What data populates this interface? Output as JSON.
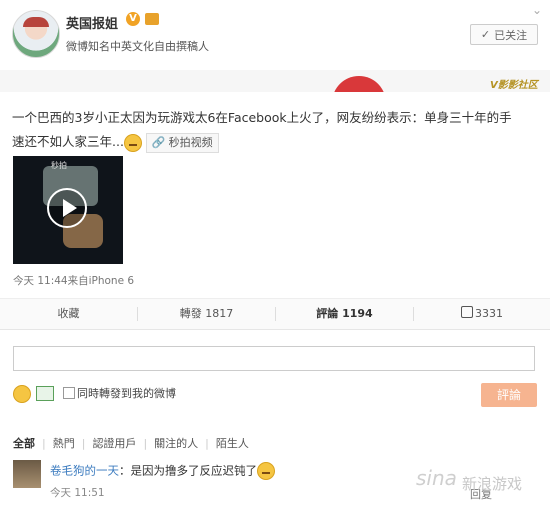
{
  "header": {
    "username": "英国报姐",
    "verified_badge": "V",
    "verify_text": "微博知名中英文化自由撰稿人",
    "follow_label": "已关注",
    "follow_icon": "check-icon"
  },
  "banner": {
    "logo_text": "V影影社区"
  },
  "post": {
    "text": "一个巴西的3岁小正太因为玩游戏太6在Facebook上火了，网友纷纷表示：单身三十年的手速还不如人家三年...",
    "video_tag": "秒拍视频",
    "video_mark": "秒拍",
    "meta": "今天 11:44来自iPhone 6"
  },
  "actions": {
    "favorite": "收藏",
    "repost": "轉發 1817",
    "comment": "評論 1194",
    "like": "3331"
  },
  "comment_box": {
    "placeholder": "",
    "repost_checkbox_label": "同時轉發到我的微博",
    "submit_label": "評論"
  },
  "filters": [
    "全部",
    "熱門",
    "認證用戶",
    "關注的人",
    "陌生人"
  ],
  "comments": [
    {
      "nickname": "卷毛狗的一天",
      "text": "：是因为撸多了反应迟钝了",
      "time": "今天 11:51",
      "reply_label": "回复"
    }
  ],
  "watermark": {
    "logo": "sina",
    "text": "新浪游戏"
  }
}
